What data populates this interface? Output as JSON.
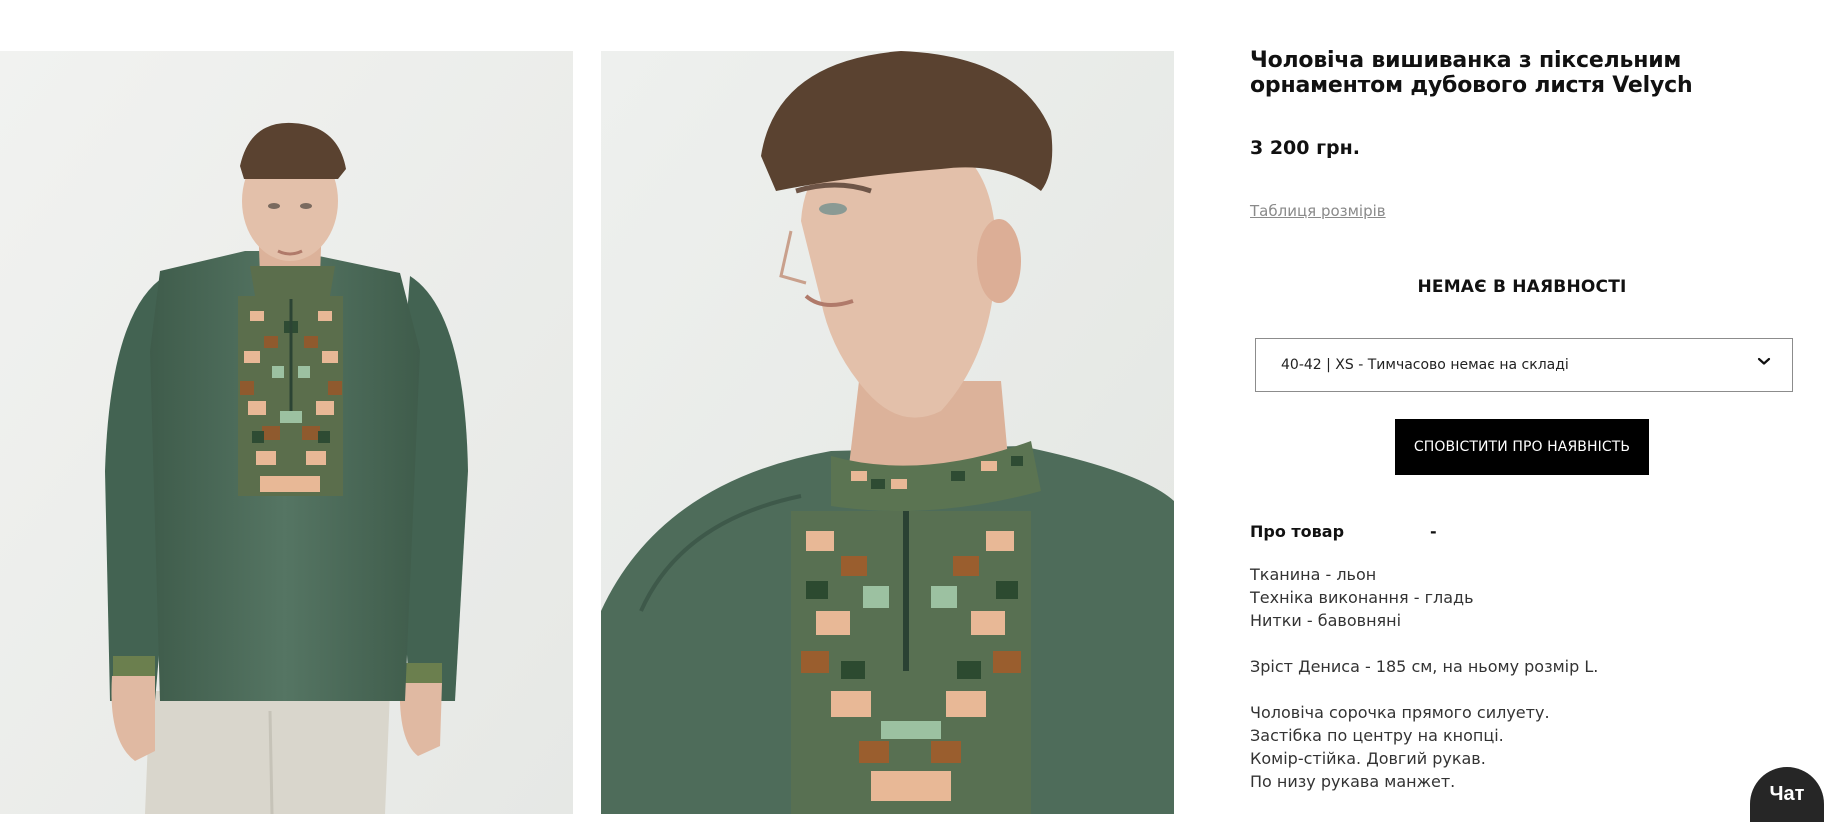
{
  "product": {
    "title": "Чоловіча вишиванка з піксельним орнаментом дубового листя Velych",
    "price": "3 200 грн.",
    "size_table_link": "Таблиця розмірів",
    "stock_status": "НЕМАЄ В НАЯВНОСТІ",
    "size_select": {
      "selected": "40-42 | XS - Тимчасово немає на складі",
      "icon": "chevron-down-icon"
    },
    "notify_button": "СПОВІСТИТИ ПРО НАЯВНІСТЬ",
    "about": {
      "label": "Про товар",
      "toggle": "-",
      "lines": [
        "Тканина - льон",
        "Техніка виконання - гладь",
        "Нитки - бавовняні",
        "",
        "Зріст Дениса - 185 см, на ньому розмір L.",
        "",
        "Чоловіча сорочка прямого силуету.",
        "Застібка по центру на кнопці.",
        "Комір-стійка. Довгий рукав.",
        "По низу рукава манжет."
      ]
    }
  },
  "chat": {
    "label": "Чат"
  },
  "colors": {
    "shirt": "#4e6c5a",
    "hair": "#5a4230",
    "skin": "#e3c0aa",
    "background": "#eef0ee",
    "button": "#000000"
  }
}
